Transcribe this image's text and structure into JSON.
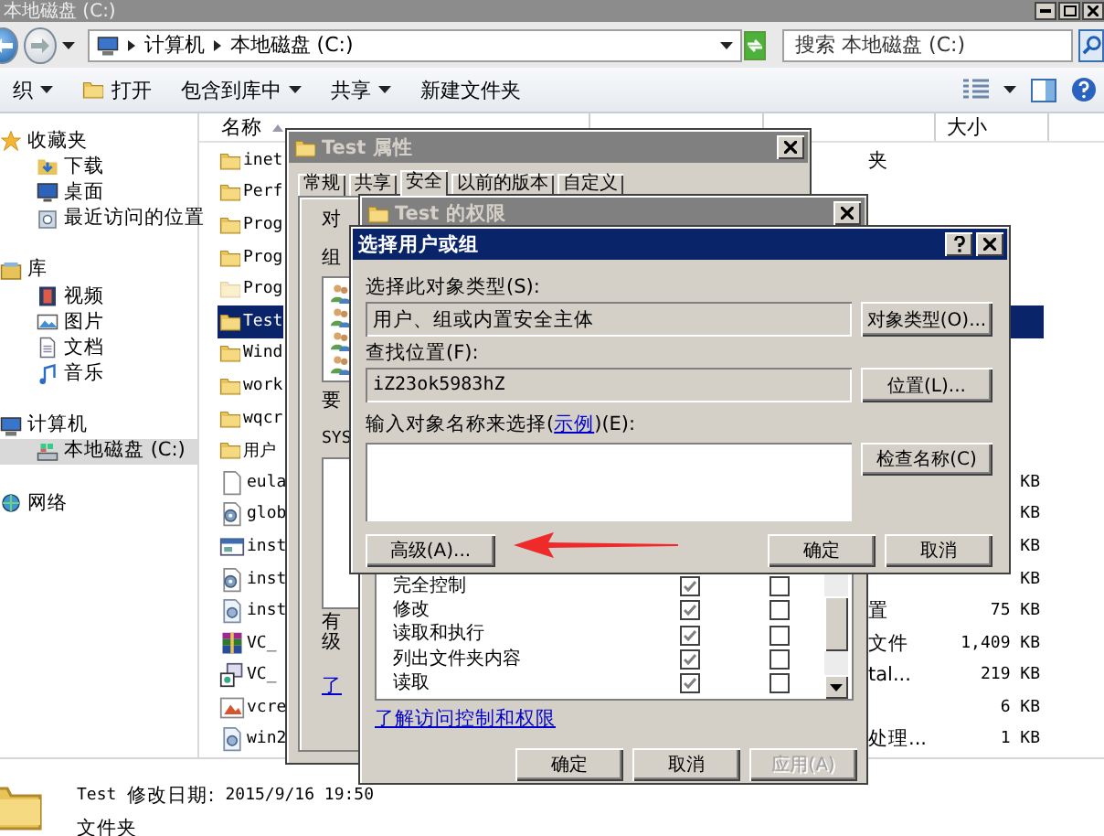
{
  "window": {
    "title": "本地磁盘 (C:)"
  },
  "address": {
    "crumbs": [
      "计算机",
      "本地磁盘 (C:)"
    ]
  },
  "search": {
    "placeholder": "搜索 本地磁盘 (C:)"
  },
  "toolbar": [
    {
      "label": "织",
      "kind": "menu"
    },
    {
      "label": "打开",
      "kind": "open"
    },
    {
      "label": "包含到库中",
      "kind": "menu"
    },
    {
      "label": "共享",
      "kind": "menu"
    },
    {
      "label": "新建文件夹",
      "kind": "plain"
    }
  ],
  "nav": [
    {
      "label": "收藏夹",
      "kind": "favorites",
      "selected": false,
      "children": [
        {
          "label": "下载",
          "kind": "downloads",
          "selected": false
        },
        {
          "label": "桌面",
          "kind": "desktop",
          "selected": false
        },
        {
          "label": "最近访问的位置",
          "kind": "recent",
          "selected": false
        }
      ]
    },
    {
      "label": "库",
      "kind": "library",
      "selected": false,
      "children": [
        {
          "label": "视频",
          "kind": "videos",
          "selected": false
        },
        {
          "label": "图片",
          "kind": "pictures",
          "selected": false
        },
        {
          "label": "文档",
          "kind": "documents",
          "selected": false
        },
        {
          "label": "音乐",
          "kind": "music",
          "selected": false
        }
      ]
    },
    {
      "label": "计算机",
      "kind": "computer",
      "selected": false,
      "children": [
        {
          "label": "本地磁盘 (C:)",
          "kind": "drive",
          "selected": true
        }
      ]
    },
    {
      "label": "网络",
      "kind": "network",
      "selected": false
    }
  ],
  "columns": [
    "名称",
    "大小"
  ],
  "files": [
    {
      "name": "inet",
      "kind": "folder",
      "type": "夹",
      "selected": false
    },
    {
      "name": "Perf",
      "kind": "folder",
      "selected": false
    },
    {
      "name": "Prog",
      "kind": "folder",
      "selected": false
    },
    {
      "name": "Prog",
      "kind": "folder",
      "selected": false
    },
    {
      "name": "Prog",
      "kind": "hidden_folder",
      "selected": false
    },
    {
      "name": "Test",
      "kind": "folder",
      "selected": true
    },
    {
      "name": "Wind",
      "kind": "folder",
      "selected": false
    },
    {
      "name": "work",
      "kind": "folder",
      "selected": false
    },
    {
      "name": "wqcr",
      "kind": "folder",
      "selected": false
    },
    {
      "name": "用户",
      "kind": "folder",
      "selected": false
    },
    {
      "name": "eula",
      "kind": "text",
      "size": "KB",
      "selected": false
    },
    {
      "name": "glob",
      "kind": "settings",
      "size": "KB",
      "selected": false
    },
    {
      "name": "inst",
      "kind": "program",
      "size": "KB",
      "selected": false
    },
    {
      "name": "inst",
      "kind": "settings",
      "size": "KB",
      "selected": false
    },
    {
      "name": "inst",
      "kind": "script",
      "type": "置",
      "size": "75 KB",
      "selected": false
    },
    {
      "name": "VC_",
      "kind": "archive",
      "type": "文件",
      "size": "1,409 KB",
      "selected": false
    },
    {
      "name": "VC_",
      "kind": "installer",
      "type": "tal...",
      "size": "219 KB",
      "selected": false
    },
    {
      "name": "vcre",
      "kind": "picture_file",
      "size": "6 KB",
      "selected": false
    },
    {
      "name": "win2",
      "kind": "script",
      "type": "处理...",
      "size": "1 KB",
      "selected": false
    }
  ],
  "details": {
    "name": "Test",
    "modified_label": "修改日期:",
    "modified": "2015/9/16 19:50",
    "type": "文件夹"
  },
  "properties_dialog": {
    "title": "Test 属性",
    "tabs": [
      {
        "label": "常规",
        "selected": false
      },
      {
        "label": "共享",
        "selected": false
      },
      {
        "label": "安全",
        "selected": true
      },
      {
        "label": "以前的版本",
        "selected": false
      },
      {
        "label": "自定义",
        "selected": false
      }
    ],
    "parts": [
      {
        "kind": "label",
        "text": "对"
      },
      {
        "kind": "label",
        "text": "组"
      },
      {
        "kind": "users"
      },
      {
        "kind": "label",
        "text": "要"
      },
      {
        "kind": "label",
        "text": "SYS"
      },
      {
        "kind": "list"
      },
      {
        "kind": "label",
        "text": "有"
      },
      {
        "kind": "label",
        "text": "级"
      },
      {
        "kind": "link",
        "text": "了"
      }
    ]
  },
  "permissions_dialog": {
    "title": "Test 的权限",
    "permissions": [
      {
        "name": "完全控制",
        "allow": true,
        "deny": false
      },
      {
        "name": "修改",
        "allow": true,
        "deny": false
      },
      {
        "name": "读取和执行",
        "allow": true,
        "deny": false
      },
      {
        "name": "列出文件夹内容",
        "allow": true,
        "deny": false
      },
      {
        "name": "读取",
        "allow": true,
        "deny": false
      }
    ],
    "link": "了解访问控制和权限",
    "buttons": [
      {
        "label": "确定",
        "disabled": false
      },
      {
        "label": "取消",
        "disabled": false
      },
      {
        "label": "应用(A)",
        "disabled": true
      }
    ]
  },
  "select_dialog": {
    "title": "选择用户或组",
    "object_type_label": "选择此对象类型(S):",
    "object_type": "用户、组或内置安全主体",
    "object_type_button": "对象类型(O)...",
    "location_label": "查找位置(F):",
    "location": "iZ23ok5983hZ",
    "location_button": "位置(L)...",
    "names_label_start": "输入对象名称来选择(",
    "names_link": "示例",
    "names_label_end": ")(E):",
    "check_button": "检查名称(C)",
    "advanced_button": "高级(A)...",
    "ok_button": "确定",
    "cancel_button": "取消"
  }
}
